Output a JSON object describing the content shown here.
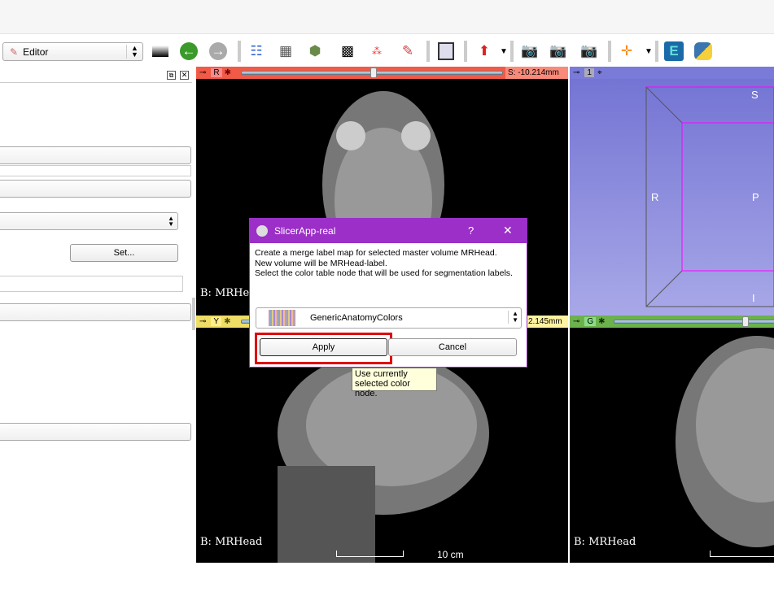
{
  "toolbar": {
    "module_selector": "Editor",
    "icons": [
      "editor-pencil-icon",
      "window-level-icon",
      "back-icon",
      "forward-icon",
      "data-icon",
      "volumes-icon",
      "models-icon",
      "transforms-icon",
      "markups-icon",
      "editor-icon",
      "layout-icon",
      "fiducial-icon",
      "screenshot-icon",
      "scene-view-icon",
      "scene-view-restore-icon",
      "crosshair-icon",
      "extension-manager-icon",
      "python-icon"
    ]
  },
  "left_panel": {
    "set_button": "Set..."
  },
  "views": {
    "red": {
      "letter": "R",
      "offset": "S: -10.214mm",
      "label": "B: MRHead",
      "color": "#f05a46"
    },
    "threed": {
      "number": "1",
      "orient_s": "S",
      "orient_r": "R",
      "orient_p": "P",
      "orient_i": "I",
      "color": "#7a7ad8"
    },
    "yellow": {
      "letter": "Y",
      "offset": "2.145mm",
      "label": "B: MRHead",
      "scale": "10 cm",
      "color": "#eedd66"
    },
    "green": {
      "letter": "G",
      "label": "B: MRHead",
      "color": "#6cb24c"
    }
  },
  "dialog": {
    "title": "SlicerApp-real",
    "help": "?",
    "close": "✕",
    "lines": [
      "Create a merge label map for selected master volume MRHead.",
      "New volume will be MRHead-label.",
      "Select the color table node that will be used for segmentation labels."
    ],
    "color_node": "GenericAnatomyColors",
    "apply": "Apply",
    "cancel": "Cancel",
    "tooltip_lines": [
      "Use currently",
      "selected color node."
    ],
    "highlight_color": "#e00000"
  }
}
